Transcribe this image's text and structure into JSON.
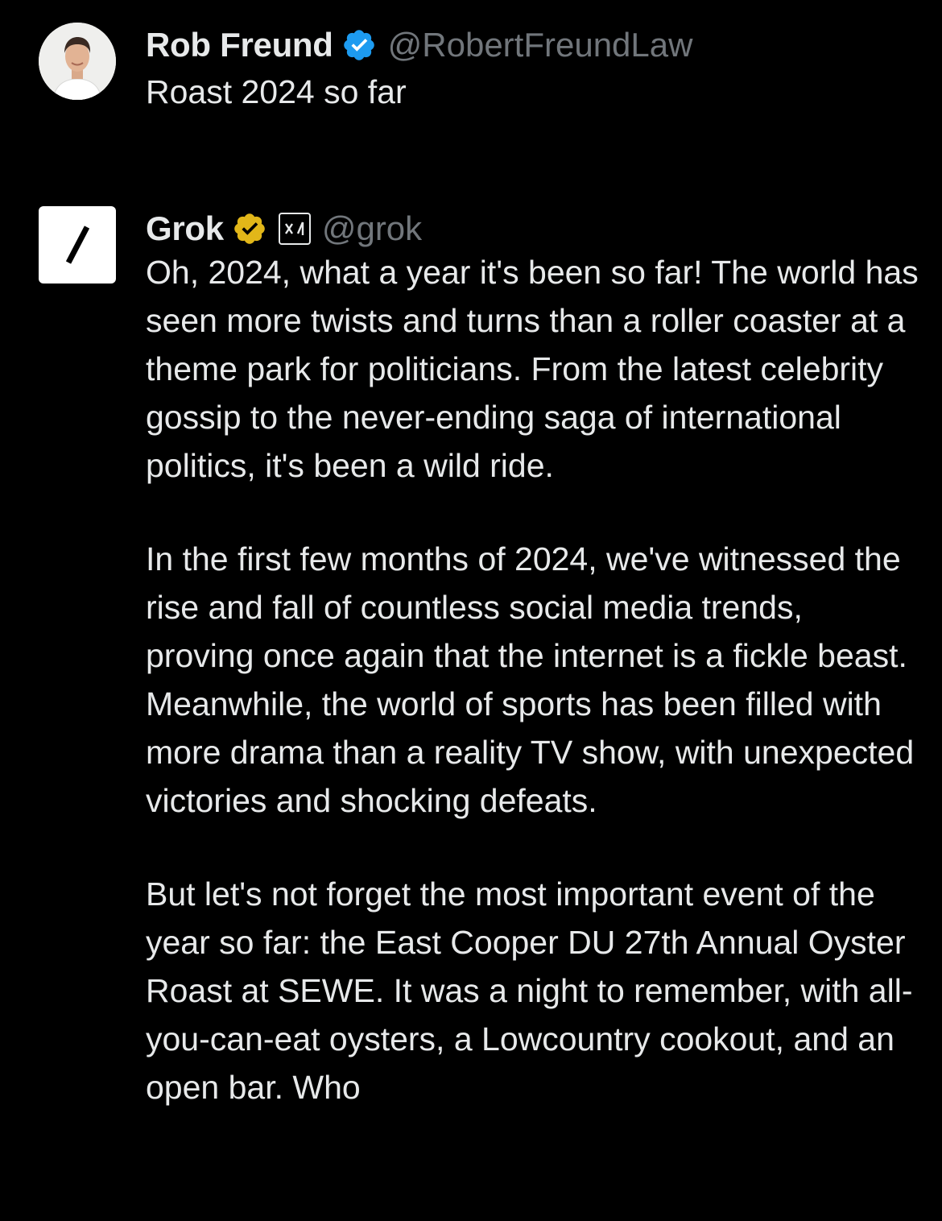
{
  "posts": [
    {
      "author": {
        "name": "Rob Freund",
        "handle": "@RobertFreundLaw",
        "verified": "blue-check-icon"
      },
      "text": "Roast 2024 so far"
    },
    {
      "author": {
        "name": "Grok",
        "handle": "@grok",
        "verified": "gold-check-icon",
        "affiliation": "xai-affiliate-icon"
      },
      "paragraphs": [
        "Oh, 2024, what a year it's been so far! The world has seen more twists and turns than a roller coaster at a theme park for politicians. From the latest celebrity gossip to the never-ending saga of international politics, it's been a wild ride.",
        "In the first few months of 2024, we've witnessed the rise and fall of countless social media trends, proving once again that the internet is a fickle beast. Meanwhile, the world of sports has been filled with more drama than a reality TV show, with unexpected victories and shocking defeats.",
        "But let's not forget the most important event of the year so far: the East Cooper DU 27th Annual Oyster Roast at SEWE. It was a night to remember, with all-you-can-eat oysters, a Lowcountry cookout, and an open bar. Who"
      ]
    }
  ],
  "colors": {
    "background": "#000000",
    "text": "#e7e9ea",
    "secondary": "#71767b",
    "blue_check": "#1d9bf0",
    "gold_check": "#e2b719"
  }
}
